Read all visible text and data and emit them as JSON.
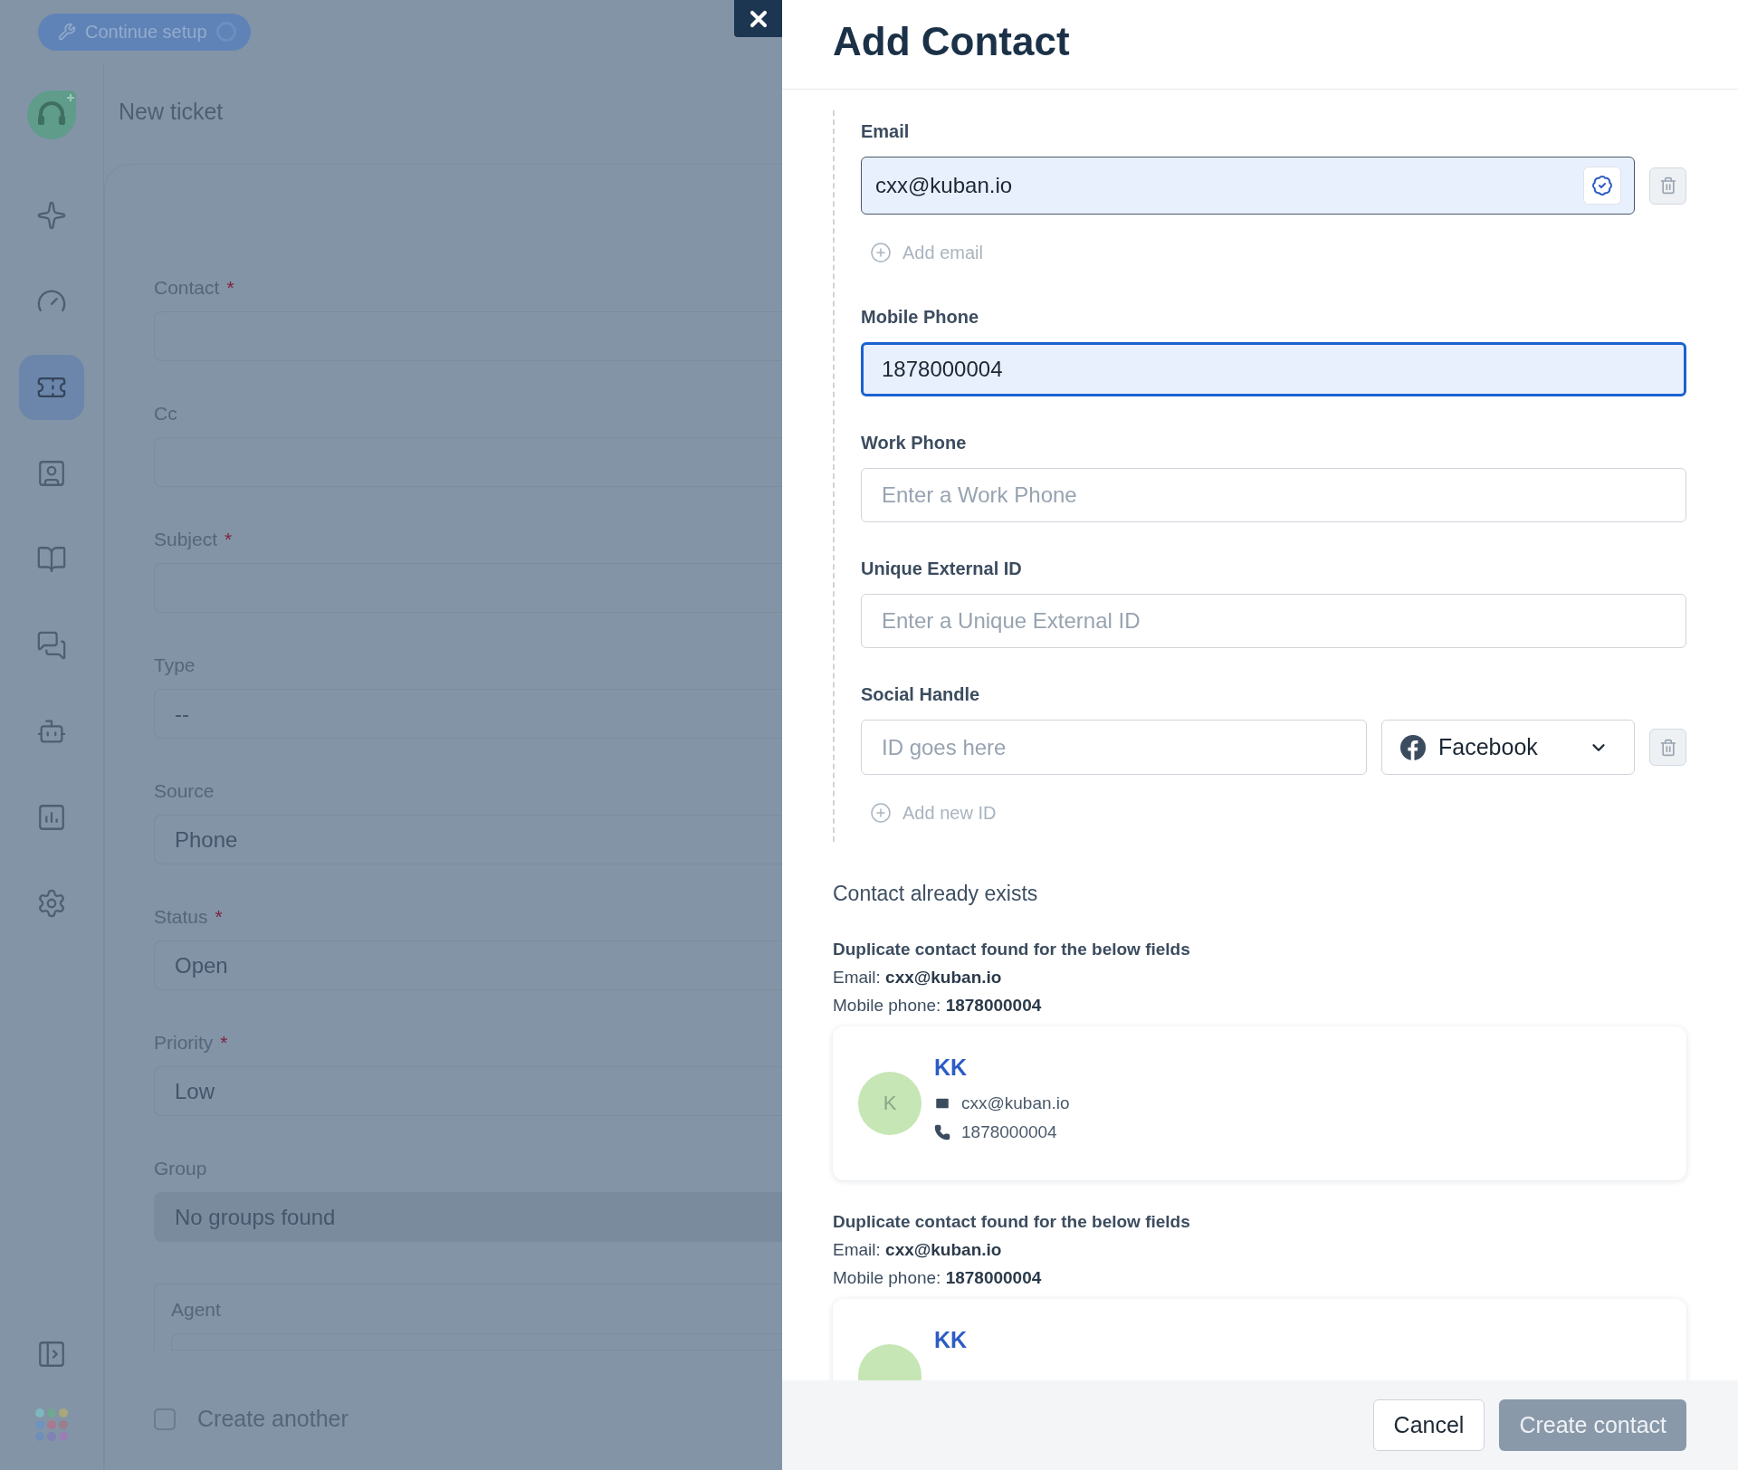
{
  "setup_button": {
    "label": "Continue setup"
  },
  "page_title": "New ticket",
  "nav": [
    {
      "kind": "sparkle",
      "selected": false
    },
    {
      "kind": "gauge",
      "selected": false
    },
    {
      "kind": "ticket",
      "selected": true
    },
    {
      "kind": "contact",
      "selected": false
    },
    {
      "kind": "book",
      "selected": false
    },
    {
      "kind": "chat",
      "selected": false
    },
    {
      "kind": "bot",
      "selected": false
    },
    {
      "kind": "chart",
      "selected": false
    },
    {
      "kind": "gear",
      "selected": false
    }
  ],
  "nav_bottom": [
    {
      "kind": "panel"
    },
    {
      "kind": "apps"
    }
  ],
  "ticket_form": {
    "fields": [
      {
        "label": "Contact",
        "required": true
      },
      {
        "label": "Cc",
        "required": false
      },
      {
        "label": "Subject",
        "required": true
      },
      {
        "label": "Type",
        "required": false,
        "value": "--"
      },
      {
        "label": "Source",
        "required": false,
        "value": "Phone"
      },
      {
        "label": "Status",
        "required": true,
        "value": "Open"
      },
      {
        "label": "Priority",
        "required": true,
        "value": "Low"
      },
      {
        "label": "Group",
        "required": false,
        "placeholder": "No groups found",
        "disabled": true
      },
      {
        "label": "Agent",
        "required": false,
        "kind": "group"
      }
    ],
    "required_mark": "*",
    "create_another": {
      "label": "Create another",
      "checked": false
    }
  },
  "dialog": {
    "title": "Add Contact",
    "email": {
      "label": "Email",
      "value": "cxx@kuban.io",
      "add_label": "Add email"
    },
    "fields": [
      {
        "label": "Mobile Phone",
        "value": "1878000004",
        "focused": true
      },
      {
        "label": "Work Phone",
        "placeholder": "Enter a Work Phone",
        "focused": false
      },
      {
        "label": "Unique External ID",
        "placeholder": "Enter a Unique External ID",
        "focused": false
      }
    ],
    "social": {
      "label": "Social Handle",
      "placeholder": "ID goes here",
      "network": "Facebook",
      "add_label": "Add new ID"
    },
    "duplicates_title": "Contact already exists",
    "duplicates": [
      {
        "heading": "Duplicate contact found for the below fields",
        "lines": [
          "Email: **cxx@kuban.io**",
          "Mobile phone: **1878000004**"
        ],
        "contact": {
          "initial": "K",
          "name": "KK",
          "email": "cxx@kuban.io",
          "phone": "1878000004"
        }
      },
      {
        "heading": "Duplicate contact found for the below fields",
        "lines": [
          "Email: **cxx@kuban.io**",
          "Mobile phone: **1878000004**"
        ],
        "contact": {
          "name": "KK"
        }
      }
    ],
    "footer": {
      "cancel": "Cancel",
      "submit": "Create contact",
      "submit_disabled": true
    }
  }
}
